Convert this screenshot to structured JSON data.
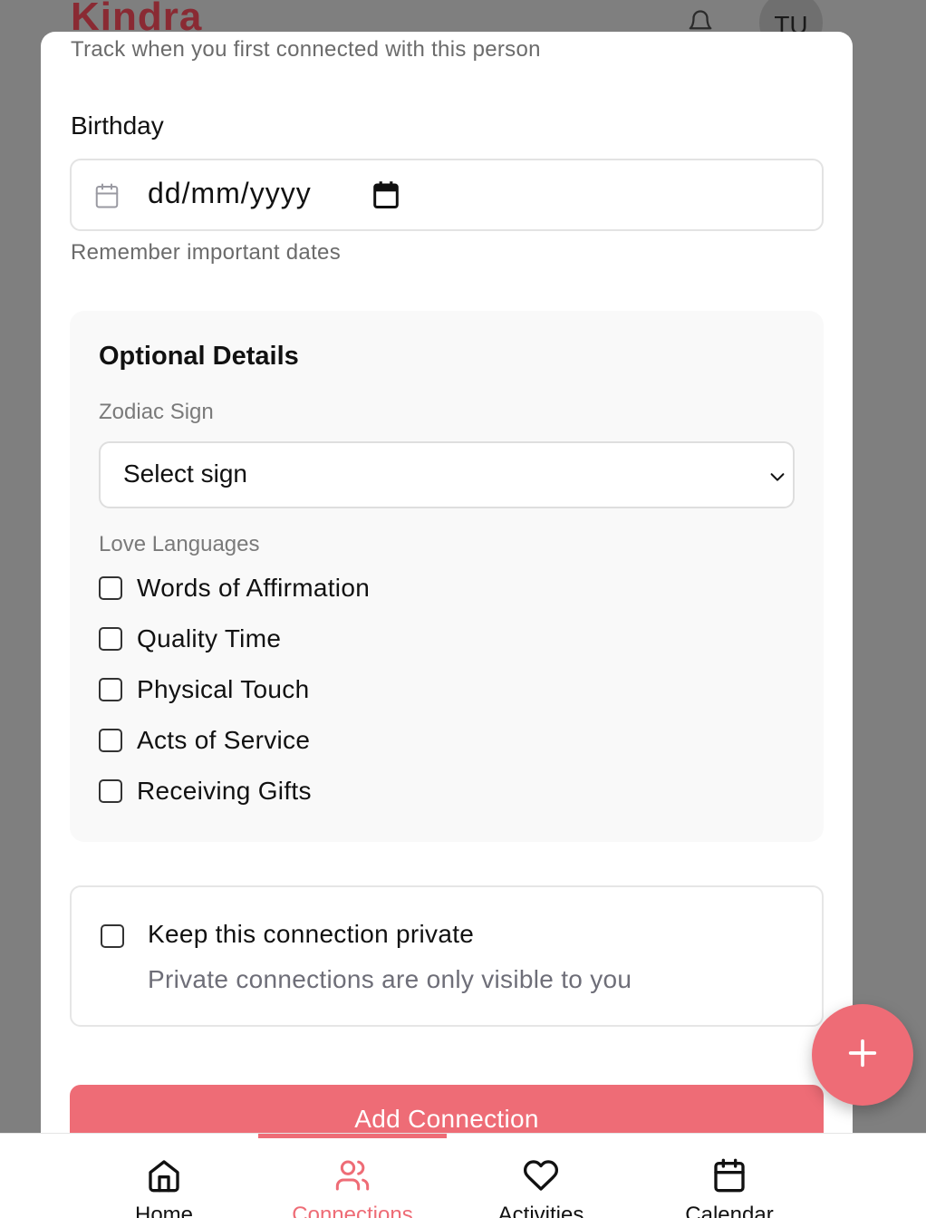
{
  "background": {
    "logo": "Kindra",
    "avatar_initials": "TU",
    "bell_icon": "bell-icon"
  },
  "form": {
    "connected_hint": "Track when you first connected with this person",
    "birthday_label": "Birthday",
    "birthday_placeholder": "dd/mm/yyyy",
    "birthday_hint": "Remember important dates",
    "optional": {
      "title": "Optional Details",
      "zodiac_label": "Zodiac Sign",
      "zodiac_value": "Select sign",
      "love_label": "Love Languages",
      "love_languages": [
        {
          "label": "Words of Affirmation",
          "checked": false
        },
        {
          "label": "Quality Time",
          "checked": false
        },
        {
          "label": "Physical Touch",
          "checked": false
        },
        {
          "label": "Acts of Service",
          "checked": false
        },
        {
          "label": "Receiving Gifts",
          "checked": false
        }
      ]
    },
    "private": {
      "title": "Keep this connection private",
      "subtitle": "Private connections are only visible to you",
      "checked": false
    },
    "submit_label": "Add Connection"
  },
  "nav": {
    "items": [
      {
        "label": "Home",
        "icon": "home-icon",
        "active": false
      },
      {
        "label": "Connections",
        "icon": "users-icon",
        "active": true
      },
      {
        "label": "Activities",
        "icon": "heart-icon",
        "active": false
      },
      {
        "label": "Calendar",
        "icon": "calendar-icon",
        "active": false
      }
    ]
  },
  "colors": {
    "accent": "#ee6c76",
    "overlay": "#7f7f7f"
  }
}
